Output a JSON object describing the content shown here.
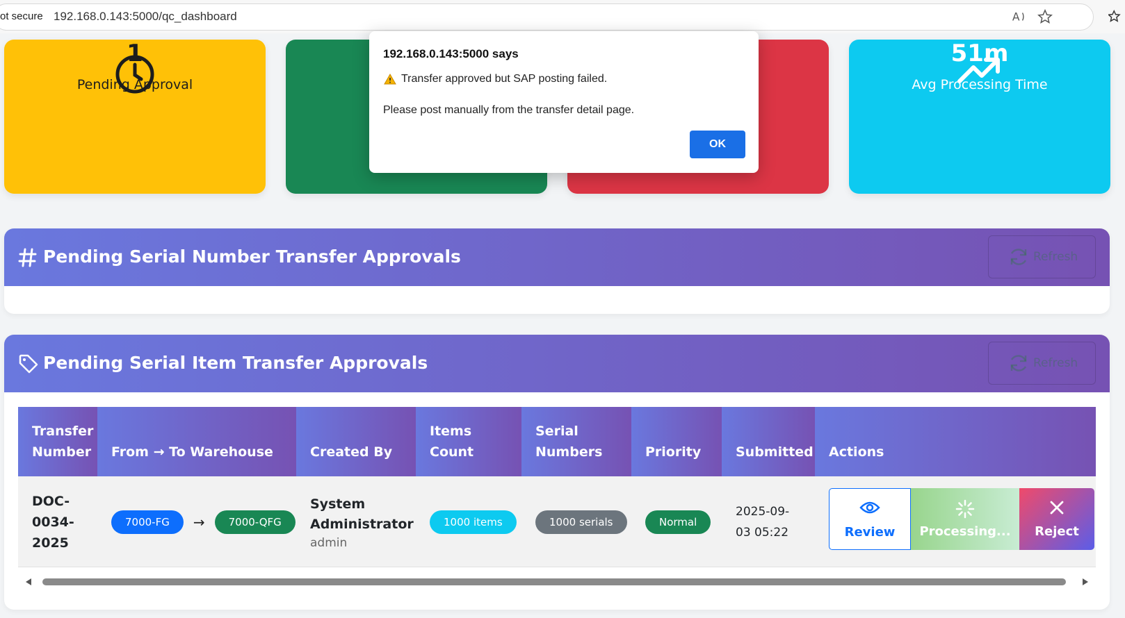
{
  "browser": {
    "security_label": "ot secure",
    "url": "192.168.0.143:5000/qc_dashboard"
  },
  "stats": [
    {
      "value": "1",
      "label": "Pending Approval",
      "icon": "clock-icon",
      "color": "#ffc107"
    },
    {
      "value": "",
      "label": "",
      "icon": "",
      "color": "#198754"
    },
    {
      "value": "",
      "label": "",
      "icon": "",
      "color": "#dc3545"
    },
    {
      "value": "51m",
      "label": "Avg Processing Time",
      "icon": "trending-up-icon",
      "color": "#0dcaf0"
    }
  ],
  "serial_number_section": {
    "title": "Pending Serial Number Transfer Approvals",
    "icon": "hash-icon",
    "refresh_label": "Refresh"
  },
  "serial_item_section": {
    "title": "Pending Serial Item Transfer Approvals",
    "icon": "tag-icon",
    "refresh_label": "Refresh",
    "columns": [
      "Transfer Number",
      "From → To Warehouse",
      "Created By",
      "Items Count",
      "Serial Numbers",
      "Priority",
      "Submitted",
      "Actions"
    ],
    "rows": [
      {
        "transfer_number": "DOC-0034-2025",
        "from_warehouse": "7000-FG",
        "to_warehouse": "7000-QFG",
        "created_by_name": "System Administrator",
        "created_by_user": "admin",
        "items_count": "1000 items",
        "serial_numbers": "1000 serials",
        "priority": "Normal",
        "submitted": "2025-09-03 05:22",
        "actions": {
          "review": "Review",
          "processing": "Processing...",
          "reject": "Reject"
        }
      }
    ]
  },
  "dialog": {
    "title": "192.168.0.143:5000 says",
    "message_line1": "Transfer approved but SAP posting failed.",
    "message_line2": "Please post manually from the transfer detail page.",
    "ok_label": "OK",
    "warning_icon": "warning-icon"
  },
  "colors": {
    "header_gradient_start": "#6a78de",
    "header_gradient_end": "#7652b3",
    "primary_pill": "#0d6efd",
    "success_pill": "#198754",
    "info_pill": "#0dcaf0",
    "secondary_pill": "#6c757d"
  }
}
